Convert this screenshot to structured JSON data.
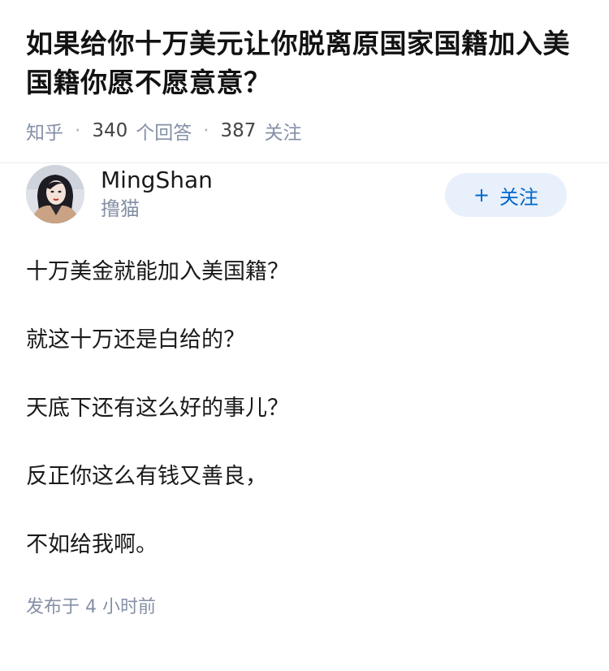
{
  "question": {
    "title": "如果给你十万美元让你脱离原国家国籍加入美国籍你愿不愿意意？",
    "source": "知乎",
    "answers_count": "340",
    "answers_label": "个回答",
    "followers_count": "387",
    "followers_label": "关注"
  },
  "author": {
    "name": "MingShan",
    "tag": "撸猫",
    "avatar_icon": "avatar-woman-portrait"
  },
  "follow_button": {
    "label": "关注",
    "icon": "plus-icon",
    "bg_color": "#e8f0fb",
    "text_color": "#0066cc"
  },
  "answer": {
    "paragraphs": [
      "十万美金就能加入美国籍？",
      "就这十万还是白给的？",
      "天底下还有这么好的事儿？",
      "反正你这么有钱又善良，",
      "不如给我啊。"
    ],
    "published": "发布于 4 小时前"
  }
}
